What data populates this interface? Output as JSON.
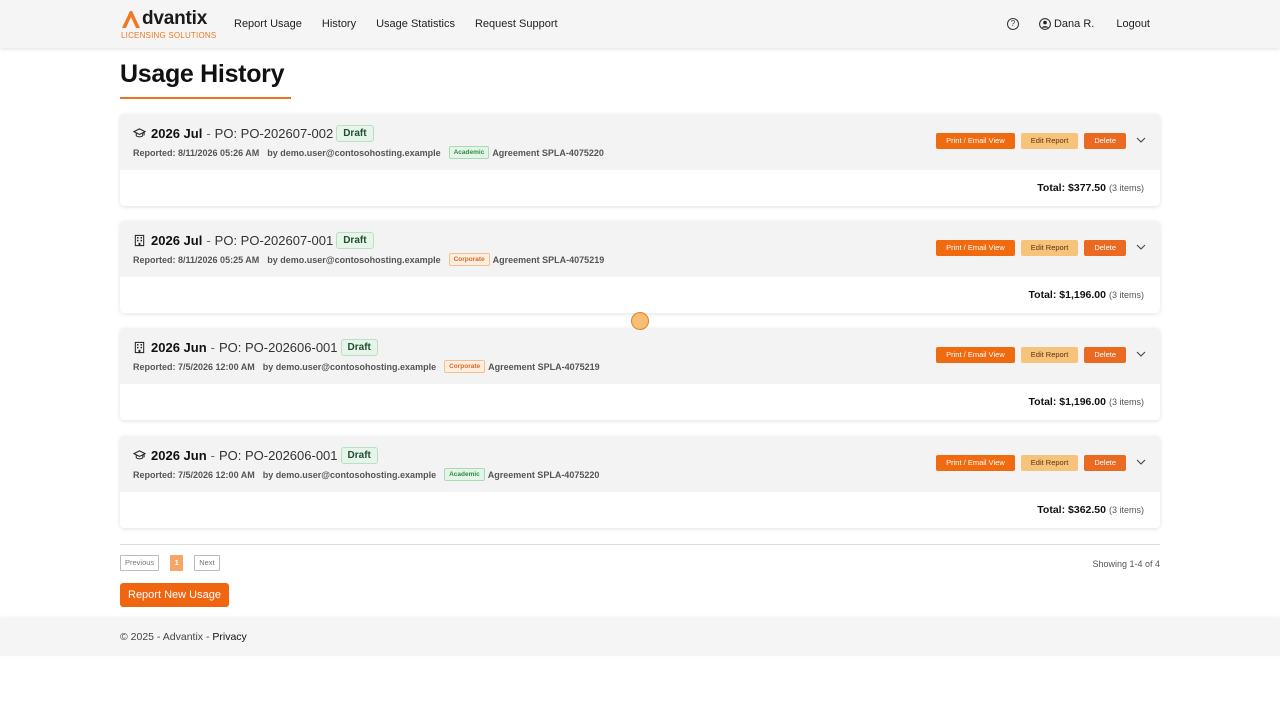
{
  "brand": {
    "name": "dvantix",
    "subtitle": "LICENSING SOLUTIONS"
  },
  "nav": {
    "links": [
      "Report Usage",
      "History",
      "Usage Statistics",
      "Request Support"
    ],
    "help": "?",
    "user": "Dana R.",
    "logout": "Logout"
  },
  "page": {
    "title": "Usage History"
  },
  "labels": {
    "print": "Print / Email View",
    "edit": "Edit Report",
    "delete": "Delete",
    "reported": "Reported:",
    "by": "by",
    "total": "Total:",
    "sep": "-"
  },
  "reports": [
    {
      "icon": "graduation-cap-icon",
      "period": "2026 Jul",
      "po": "PO: PO-202607-002",
      "status": "Draft",
      "reported": "8/11/2026 05:26 AM",
      "user": "demo.user@contosohosting.example",
      "type": "Academic",
      "agreement": "Agreement SPLA-4075220",
      "total": "$377.50",
      "items": "(3 items)"
    },
    {
      "icon": "building-icon",
      "period": "2026 Jul",
      "po": "PO: PO-202607-001",
      "status": "Draft",
      "reported": "8/11/2026 05:25 AM",
      "user": "demo.user@contosohosting.example",
      "type": "Corporate",
      "agreement": "Agreement SPLA-4075219",
      "total": "$1,196.00",
      "items": "(3 items)"
    },
    {
      "icon": "building-icon",
      "period": "2026 Jun",
      "po": "PO: PO-202606-001",
      "status": "Draft",
      "reported": "7/5/2026 12:00 AM",
      "user": "demo.user@contosohosting.example",
      "type": "Corporate",
      "agreement": "Agreement SPLA-4075219",
      "total": "$1,196.00",
      "items": "(3 items)"
    },
    {
      "icon": "graduation-cap-icon",
      "period": "2026 Jun",
      "po": "PO: PO-202606-001",
      "status": "Draft",
      "reported": "7/5/2026 12:00 AM",
      "user": "demo.user@contosohosting.example",
      "type": "Academic",
      "agreement": "Agreement SPLA-4075220",
      "total": "$362.50",
      "items": "(3 items)"
    }
  ],
  "pagination": {
    "previous": "Previous",
    "current": "1",
    "next": "Next",
    "showing": "Showing 1-4 of 4"
  },
  "actions": {
    "report_new": "Report New Usage"
  },
  "footer": {
    "copyright": "© 2025 - Advantix - ",
    "privacy": "Privacy"
  },
  "colors": {
    "accent": "#f06a10",
    "edit": "#f7c27a",
    "academic": "#2f8a48",
    "corporate": "#d9692a"
  }
}
